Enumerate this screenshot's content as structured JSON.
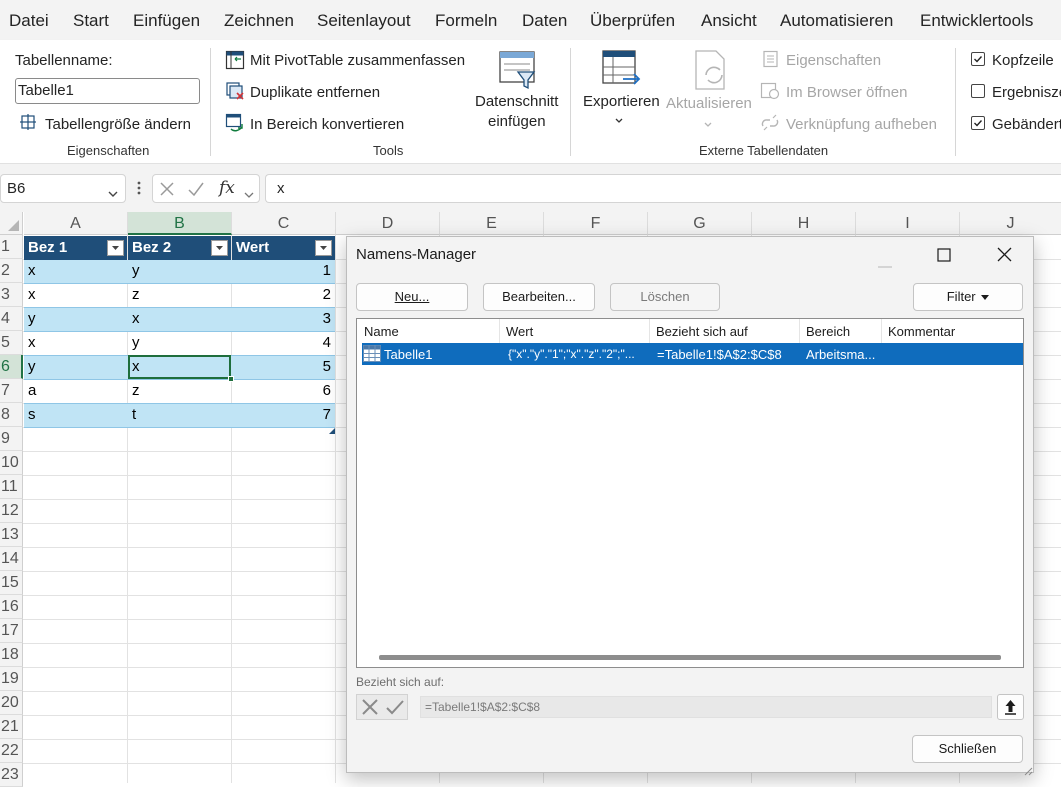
{
  "menu": [
    "Datei",
    "Start",
    "Einfügen",
    "Zeichnen",
    "Seitenlayout",
    "Formeln",
    "Daten",
    "Überprüfen",
    "Ansicht",
    "Automatisieren",
    "Entwicklertools"
  ],
  "ribbon": {
    "table_name_label": "Tabellenname:",
    "table_name_value": "Tabelle1",
    "resize_table": "Tabellengröße ändern",
    "group_properties": "Eigenschaften",
    "pivot": "Mit PivotTable zusammenfassen",
    "remove_duplicates": "Duplikate entfernen",
    "convert_range": "In Bereich konvertieren",
    "slicer_line1": "Datenschnitt",
    "slicer_line2": "einfügen",
    "group_tools": "Tools",
    "export": "Exportieren",
    "refresh": "Aktualisieren",
    "ext_properties": "Eigenschaften",
    "open_browser": "Im Browser öffnen",
    "unlink": "Verknüpfung aufheben",
    "group_external": "Externe Tabellendaten",
    "header_row": "Kopfzeile",
    "total_row": "Ergebnisze",
    "banded_rows": "Gebändert",
    "header_row_checked": true,
    "total_row_checked": false,
    "banded_rows_checked": true
  },
  "formula_bar": {
    "name_box": "B6",
    "fx": "fx",
    "content": "x"
  },
  "columns": [
    "A",
    "B",
    "C",
    "D",
    "E",
    "F",
    "G",
    "H",
    "I",
    "J"
  ],
  "rows": [
    "1",
    "2",
    "3",
    "4",
    "5",
    "6",
    "7",
    "8",
    "9",
    "10",
    "11",
    "12",
    "13",
    "14",
    "15",
    "16",
    "17",
    "18",
    "19",
    "20",
    "21",
    "22",
    "23"
  ],
  "table": {
    "headers": [
      "Bez 1",
      "Bez 2",
      "Wert"
    ],
    "data": [
      [
        "x",
        "y",
        "1"
      ],
      [
        "x",
        "z",
        "2"
      ],
      [
        "y",
        "x",
        "3"
      ],
      [
        "x",
        "y",
        "4"
      ],
      [
        "y",
        "x",
        "5"
      ],
      [
        "a",
        "z",
        "6"
      ],
      [
        "s",
        "t",
        "7"
      ]
    ]
  },
  "dialog": {
    "title": "Namens-Manager",
    "btn_new": "Neu...",
    "btn_edit": "Bearbeiten...",
    "btn_delete": "Löschen",
    "btn_filter": "Filter",
    "list_headers": [
      "Name",
      "Wert",
      "Bezieht sich auf",
      "Bereich",
      "Kommentar"
    ],
    "items": [
      {
        "name": "Tabelle1",
        "value": "{\"x\".\"y\".\"1\";\"x\".\"z\".\"2\";\"...",
        "refers_to": "=Tabelle1!$A$2:$C$8",
        "scope": "Arbeitsma...",
        "comment": ""
      }
    ],
    "refers_label": "Bezieht sich auf:",
    "refers_value": "=Tabelle1!$A$2:$C$8",
    "btn_close": "Schließen"
  }
}
